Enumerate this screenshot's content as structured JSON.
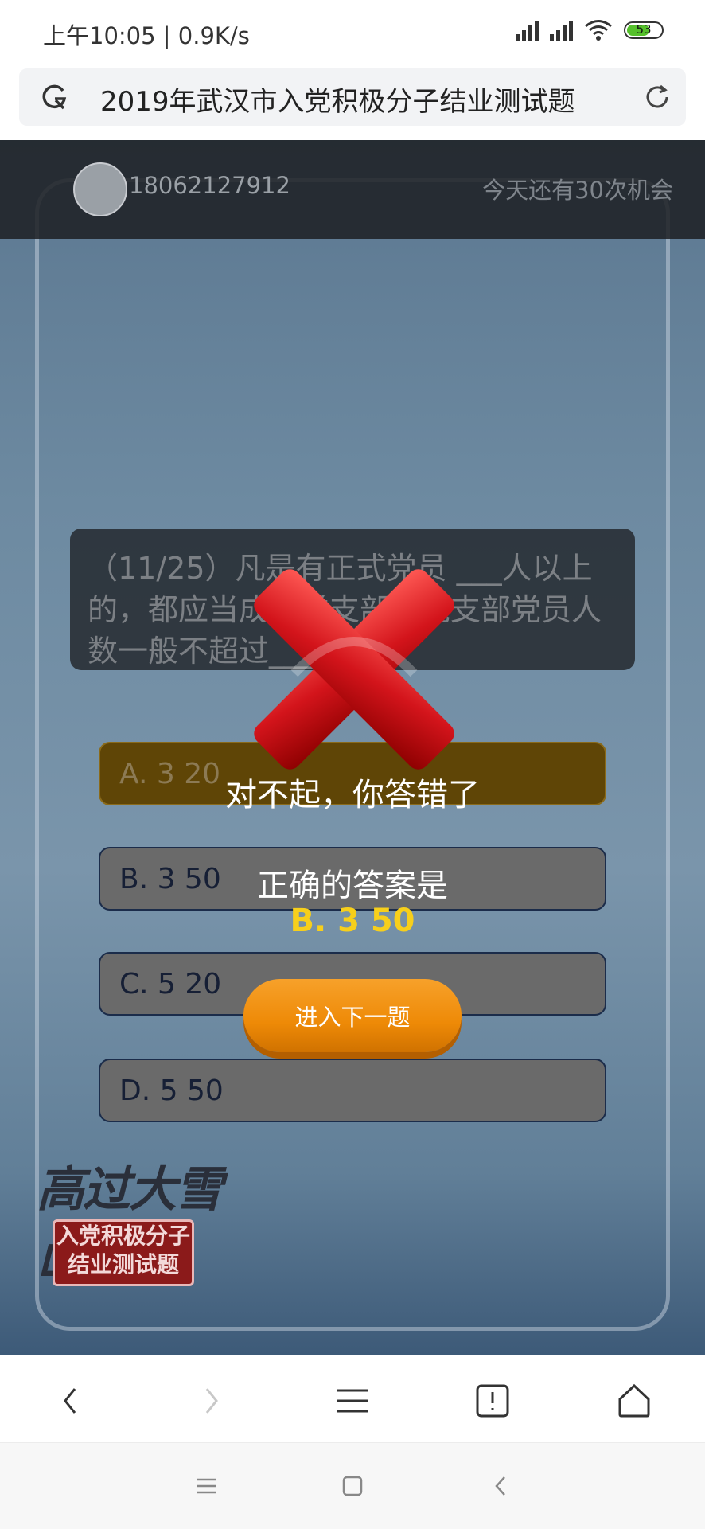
{
  "status_bar": {
    "time": "上午10:05",
    "speed": "0.9K/s",
    "battery": "53"
  },
  "url_bar": {
    "title": "2019年武汉市入党积极分子结业测试题"
  },
  "quiz": {
    "phone": "18062127912",
    "chances": "今天还有30次机会",
    "question": "（11/25）凡是有正式党员 ___人以上的，都应当成立党支部。党支部党员人数一般不超过___人",
    "options": [
      "A. 3 20",
      "B. 3 50",
      "C. 5 20",
      "D. 5 50"
    ],
    "logo_calligraphy": "高过大雪山",
    "logo_line1": "入党积极分子",
    "logo_line2": "结业测试题"
  },
  "result": {
    "wrong_message": "对不起，你答错了",
    "correct_label": "正确的答案是",
    "correct_answer": "B. 3 50",
    "next_button": "进入下一题"
  },
  "colors": {
    "accent_orange": "#ee8a07",
    "answer_yellow": "#f7cf1b",
    "wrong_red": "#d3141b"
  }
}
